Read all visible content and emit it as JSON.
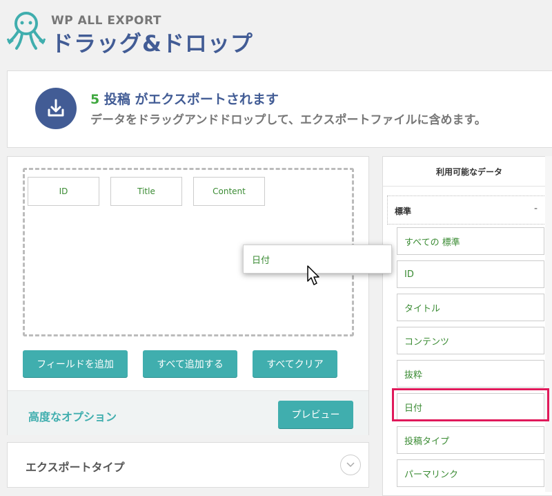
{
  "brand": {
    "sub": "WP ALL EXPORT",
    "main": "ドラッグ&ドロップ"
  },
  "summary": {
    "count": "5",
    "line1_rest": " 投稿 がエクスポートされます",
    "line2": "データをドラッグアンドドロップして、エクスポートファイルに含めます。"
  },
  "drop_zone": {
    "fields": [
      "ID",
      "Title",
      "Content"
    ]
  },
  "actions": {
    "add_field": "フィールドを追加",
    "add_all": "すべて追加する",
    "clear_all": "すべてクリア"
  },
  "advanced": {
    "label": "高度なオプション",
    "preview": "プレビュー"
  },
  "export_type": {
    "label": "エクスポートタイプ"
  },
  "available": {
    "title": "利用可能なデータ",
    "section": "標準",
    "toggle": "-",
    "items": [
      "すべての 標準",
      "ID",
      "タイトル",
      "コンテンツ",
      "抜粋",
      "日付",
      "投稿タイプ",
      "パーマリンク"
    ]
  },
  "dragging": {
    "label": "日付"
  },
  "colors": {
    "brand_blue": "#425c95",
    "teal": "#40aeae",
    "field_green": "#3a8b33",
    "highlight_pink": "#e0195a"
  }
}
